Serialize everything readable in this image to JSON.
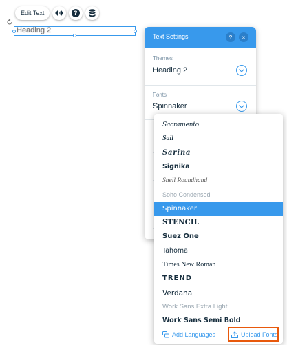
{
  "toolbar": {
    "edit_text_label": "Edit Text",
    "animation_icon": "animation-icon",
    "help_icon": "help-icon",
    "layers_icon": "layers-icon"
  },
  "element": {
    "text": "Heading 2"
  },
  "panel": {
    "title": "Text Settings",
    "help_label": "?",
    "close_label": "×",
    "themes_label": "Themes",
    "themes_value": "Heading 2",
    "fonts_label": "Fonts",
    "fonts_value": "Spinnaker"
  },
  "fonts": [
    {
      "label": "Sacramento"
    },
    {
      "label": "Sail"
    },
    {
      "label": "Sarina"
    },
    {
      "label": "Signika"
    },
    {
      "label": "Snell Roundhand"
    },
    {
      "label": "Soho Condensed"
    },
    {
      "label": "Spinnaker"
    },
    {
      "label": "STENCIL"
    },
    {
      "label": "Suez One"
    },
    {
      "label": "Tahoma"
    },
    {
      "label": "Times New Roman"
    },
    {
      "label": "TREND"
    },
    {
      "label": "Verdana"
    },
    {
      "label": "Work Sans Extra Light"
    },
    {
      "label": "Work Sans Semi Bold"
    }
  ],
  "selected_font": "Spinnaker",
  "footer": {
    "add_languages": "Add Languages",
    "upload_fonts": "Upload Fonts"
  },
  "colors": {
    "accent": "#3899ec",
    "highlight": "#e8590c"
  }
}
